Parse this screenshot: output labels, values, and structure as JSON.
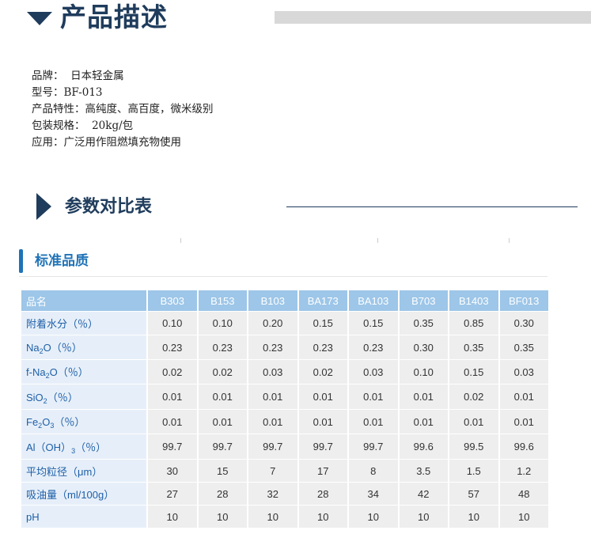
{
  "section1": {
    "title": "产品描述"
  },
  "description": [
    "品牌：  日本轻金属",
    "型号：BF-013",
    "产品特性：高纯度、高百度，微米级别",
    "包装规格：  20kg/包",
    "应用：广泛用作阻燃填充物使用"
  ],
  "section2": {
    "title": "参数对比表"
  },
  "section3": {
    "title": "标准品质"
  },
  "table": {
    "headers": [
      "品名",
      "B303",
      "B153",
      "B103",
      "BA173",
      "BA103",
      "B703",
      "B1403",
      "BF013"
    ],
    "rows": [
      {
        "label_parts": [
          [
            "附着水分（％）",
            ""
          ]
        ],
        "values": [
          "0.10",
          "0.10",
          "0.20",
          "0.15",
          "0.15",
          "0.35",
          "0.85",
          "0.30"
        ]
      },
      {
        "label_parts": [
          [
            "Na",
            ""
          ],
          [
            "2",
            "sub"
          ],
          [
            "O（％）",
            ""
          ]
        ],
        "values": [
          "0.23",
          "0.23",
          "0.23",
          "0.23",
          "0.23",
          "0.30",
          "0.35",
          "0.35"
        ]
      },
      {
        "label_parts": [
          [
            "f-Na",
            ""
          ],
          [
            "2",
            "sub"
          ],
          [
            "O（％）",
            ""
          ]
        ],
        "values": [
          "0.02",
          "0.02",
          "0.03",
          "0.02",
          "0.03",
          "0.10",
          "0.15",
          "0.03"
        ]
      },
      {
        "label_parts": [
          [
            "SiO",
            ""
          ],
          [
            "2",
            "sub"
          ],
          [
            "（％）",
            ""
          ]
        ],
        "values": [
          "0.01",
          "0.01",
          "0.01",
          "0.01",
          "0.01",
          "0.01",
          "0.02",
          "0.01"
        ]
      },
      {
        "label_parts": [
          [
            "Fe",
            ""
          ],
          [
            "2",
            "sub"
          ],
          [
            "O",
            ""
          ],
          [
            "3",
            "sub"
          ],
          [
            "（％）",
            ""
          ]
        ],
        "values": [
          "0.01",
          "0.01",
          "0.01",
          "0.01",
          "0.01",
          "0.01",
          "0.01",
          "0.01"
        ]
      },
      {
        "label_parts": [
          [
            "Al（OH）",
            ""
          ],
          [
            "3",
            "sub"
          ],
          [
            "（％）",
            ""
          ]
        ],
        "values": [
          "99.7",
          "99.7",
          "99.7",
          "99.7",
          "99.7",
          "99.6",
          "99.5",
          "99.6"
        ]
      },
      {
        "label_parts": [
          [
            "平均粒径（μm）",
            ""
          ]
        ],
        "values": [
          "30",
          "15",
          "7",
          "17",
          "8",
          "3.5",
          "1.5",
          "1.2"
        ]
      },
      {
        "label_parts": [
          [
            "吸油量（ml/100g）",
            ""
          ]
        ],
        "values": [
          "27",
          "28",
          "32",
          "28",
          "34",
          "42",
          "57",
          "48"
        ]
      },
      {
        "label_parts": [
          [
            "pH",
            ""
          ]
        ],
        "values": [
          "10",
          "10",
          "10",
          "10",
          "10",
          "10",
          "10",
          "10"
        ]
      }
    ]
  }
}
